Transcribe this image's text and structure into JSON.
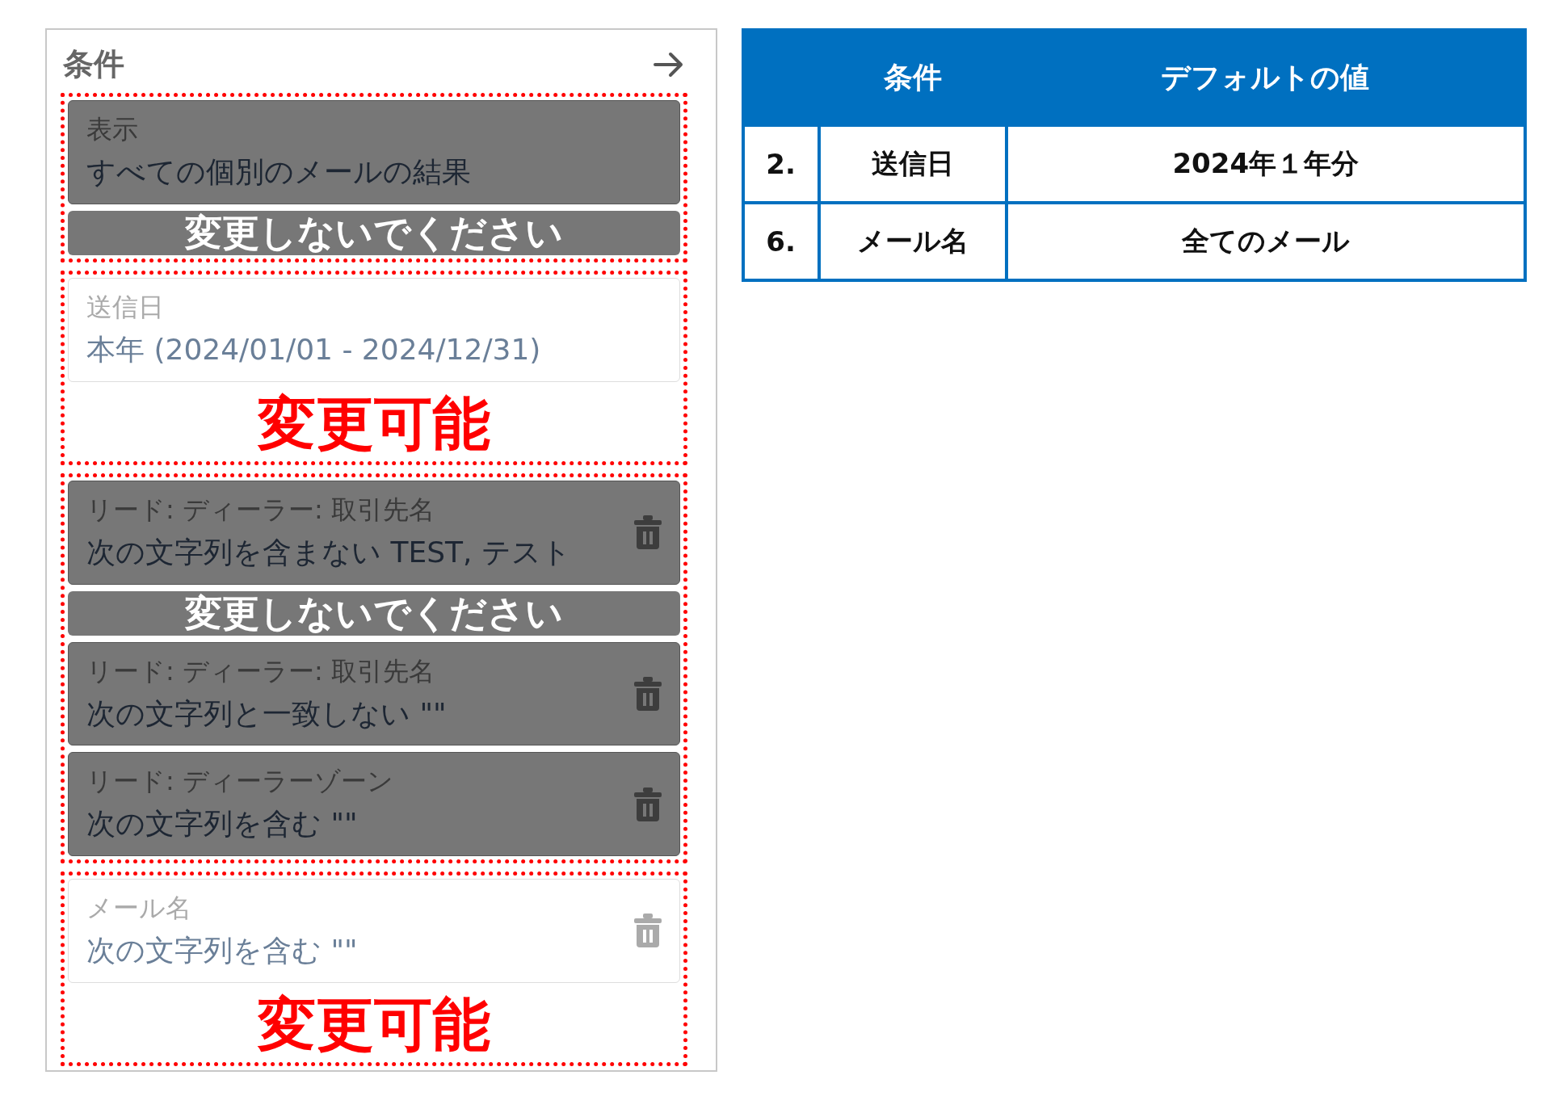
{
  "panel": {
    "title": "条件",
    "sections": [
      {
        "annotation": {
          "text": "変更しないでください",
          "kind": "locked"
        },
        "cards": [
          {
            "label": "表示",
            "value": "すべての個別のメールの結果",
            "deletable": false
          }
        ]
      },
      {
        "annotation": {
          "text": "変更可能",
          "kind": "editable"
        },
        "cards": [
          {
            "label": "送信日",
            "value": "本年 (2024/01/01 - 2024/12/31)",
            "deletable": false
          }
        ]
      },
      {
        "annotation": {
          "text": "変更しないでください",
          "kind": "locked"
        },
        "cards": [
          {
            "label": "リード: ディーラー: 取引先名",
            "value": "次の文字列を含まない TEST, テスト",
            "deletable": true
          },
          {
            "label": "リード: ディーラー: 取引先名",
            "value": "次の文字列と一致しない \"\"",
            "deletable": true
          },
          {
            "label": "リード: ディーラーゾーン",
            "value": "次の文字列を含む \"\"",
            "deletable": true
          }
        ]
      },
      {
        "annotation": {
          "text": "変更可能",
          "kind": "editable"
        },
        "cards": [
          {
            "label": "メール名",
            "value": "次の文字列を含む \"\"",
            "deletable": true
          }
        ]
      }
    ]
  },
  "table": {
    "columns": [
      "条件",
      "デフォルトの値"
    ],
    "rows": [
      {
        "number": "2.",
        "condition": "送信日",
        "default": "2024年１年分"
      },
      {
        "number": "6.",
        "condition": "メール名",
        "default": "全てのメール"
      }
    ]
  }
}
